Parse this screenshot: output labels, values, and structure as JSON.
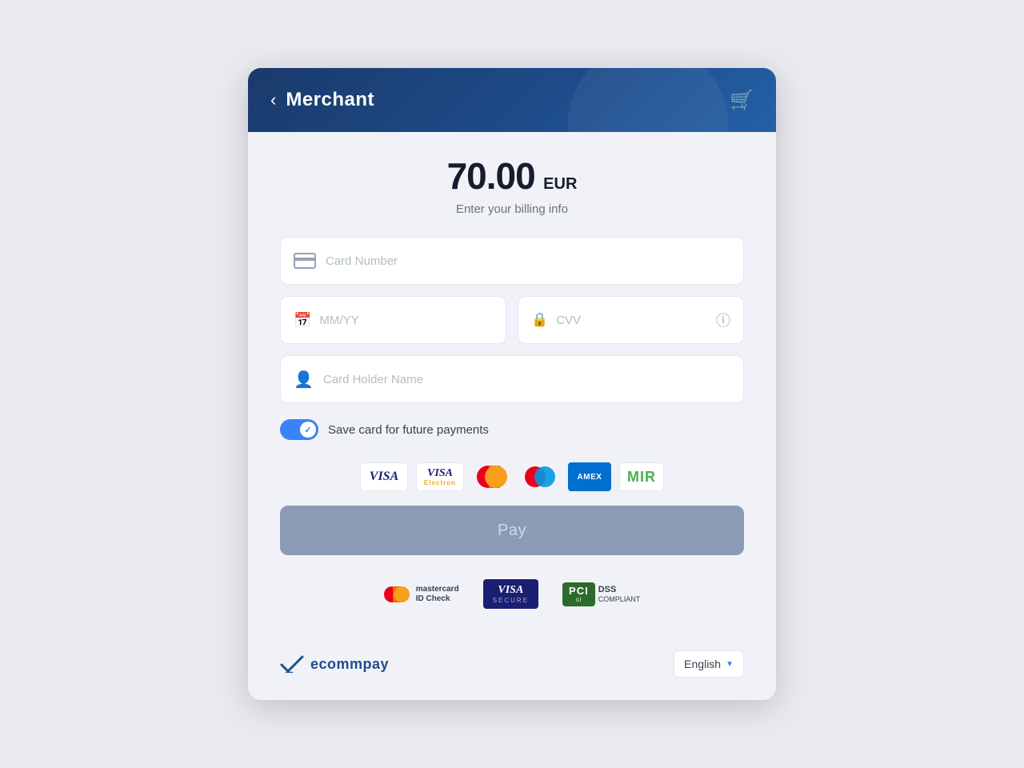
{
  "header": {
    "title": "Merchant",
    "back_label": "‹",
    "cart_icon": "🛒"
  },
  "amount": {
    "value": "70.00",
    "currency": "EUR",
    "subtitle": "Enter your billing info"
  },
  "form": {
    "card_number_placeholder": "Card Number",
    "expiry_placeholder": "MM/YY",
    "cvv_placeholder": "CVV",
    "cardholder_placeholder": "Card Holder Name"
  },
  "toggle": {
    "label": "Save card for future payments",
    "enabled": true
  },
  "pay_button": {
    "label": "Pay"
  },
  "language": {
    "selected": "English",
    "arrow": "▼"
  },
  "footer": {
    "brand": "ecommpay"
  },
  "security": {
    "mastercard_id_check": "mastercard\nID Check",
    "visa_secure_label": "VISA",
    "visa_secure_sub": "SECURE",
    "pci_label": "PCI",
    "pci_sub": "DSS",
    "pci_compliant": "COMPLIANT"
  }
}
